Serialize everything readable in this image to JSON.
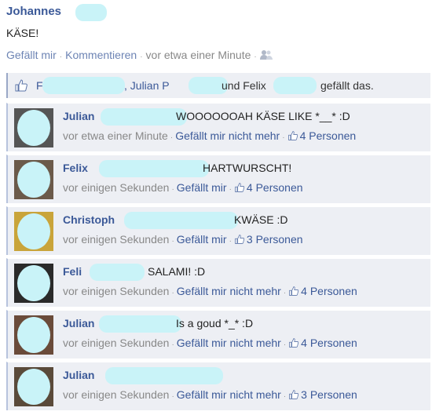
{
  "post": {
    "author": "Johannes",
    "text": "KÄSE!",
    "like_label": "Gefällt mir",
    "comment_label": "Kommentieren",
    "time": "vor etwa einer Minute"
  },
  "likes": {
    "name1": "F",
    "name2": ", Julian P",
    "name3": "und Felix",
    "suffix": "gefällt das."
  },
  "comments": [
    {
      "name": "Julian",
      "text": "WOOOOOOAH KÄSE LIKE *__* :D",
      "time": "vor etwa einer Minute",
      "action": "Gefällt mir nicht mehr",
      "likes": "4 Personen"
    },
    {
      "name": "Felix",
      "text": "HARTWURSCHT!",
      "time": "vor einigen Sekunden",
      "action": "Gefällt mir",
      "likes": "4 Personen"
    },
    {
      "name": "Christoph",
      "text": "KWÄSE :D",
      "time": "vor einigen Sekunden",
      "action": "Gefällt mir",
      "likes": "3 Personen"
    },
    {
      "name": "Feli",
      "text": "SALAMI! :D",
      "time": "vor einigen Sekunden",
      "action": "Gefällt mir nicht mehr",
      "likes": "4 Personen"
    },
    {
      "name": "Julian",
      "text": "Is a goud *_* :D",
      "time": "vor einigen Sekunden",
      "action": "Gefällt mir nicht mehr",
      "likes": "4 Personen"
    },
    {
      "name": "Julian",
      "text": "",
      "time": "vor einigen Sekunden",
      "action": "Gefällt mir nicht mehr",
      "likes": "3 Personen"
    }
  ],
  "icons": {
    "thumb": "thumbs-up-icon",
    "people": "people-icon"
  },
  "colors": {
    "link": "#3b5998",
    "panel": "#edeff4",
    "censor": "#c9f3f8"
  }
}
